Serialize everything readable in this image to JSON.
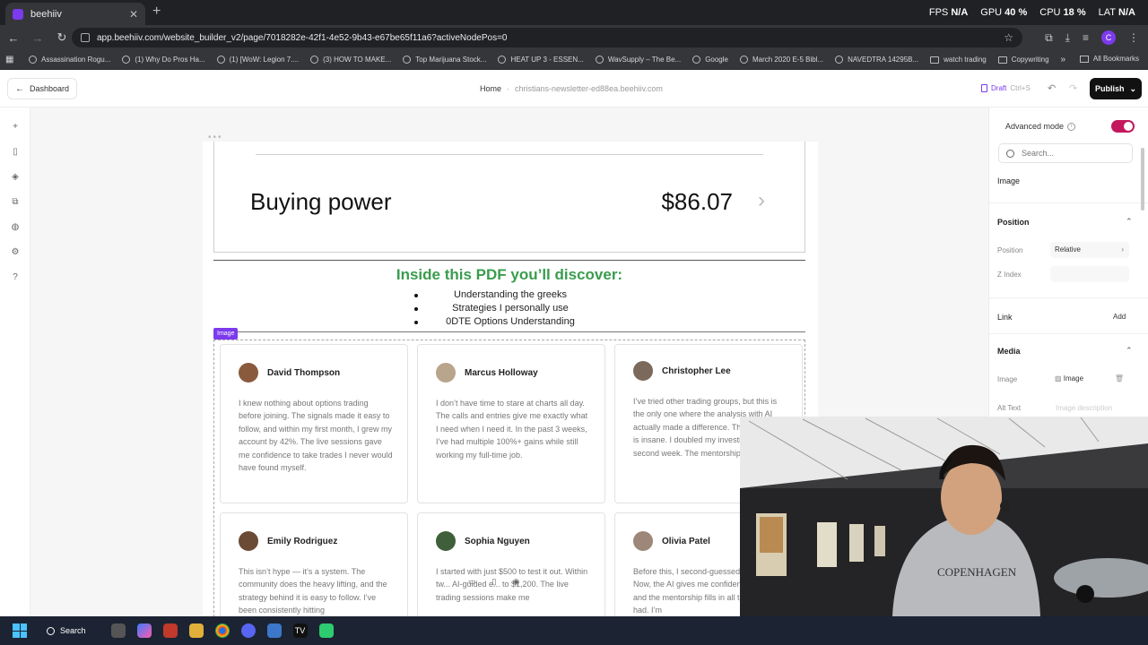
{
  "browser": {
    "tab_title": "beehiiv",
    "url": "app.beehiiv.com/website_builder_v2/page/7018282e-42f1-4e52-9b43-e67be65f11a6?activeNodePos=0",
    "overlay": {
      "fps_label": "FPS",
      "fps_value": "N/A",
      "gpu_label": "GPU",
      "gpu_value": "40 %",
      "cpu_label": "CPU",
      "cpu_value": "18 %",
      "lat_label": "LAT",
      "lat_value": "N/A"
    },
    "bookmarks": [
      "Assassination Rogu...",
      "(1) Why Do Pros Ha...",
      "(1) [WoW: Legion 7....",
      "(3) HOW TO MAKE...",
      "Top Marijuana Stock...",
      "HEAT UP 3 - ESSEN...",
      "WavSupply – The Be...",
      "Google",
      "March 2020 E-5 Bibl...",
      "NAVEDTRA 14295B...",
      "watch trading",
      "Copywriting"
    ],
    "all_bookmarks": "All Bookmarks",
    "profile_initial": "C"
  },
  "header": {
    "dashboard_label": "Dashboard",
    "breadcrumb_home": "Home",
    "breadcrumb_sep": "·",
    "breadcrumb_site": "christians-newsletter-ed88ea.beehiiv.com",
    "draft_label": "Draft",
    "draft_shortcut": "Ctrl+S",
    "publish_label": "Publish"
  },
  "canvas": {
    "buying_power_label": "Buying power",
    "buying_power_value": "$86.07",
    "pdf_title": "Inside this PDF you’ll discover:",
    "pdf_items": [
      "Understanding the greeks",
      "Strategies I personally use",
      "0DTE Options Understanding"
    ],
    "image_tag": "Image",
    "testimonials": [
      {
        "name": "David Thompson",
        "quote": "I knew nothing about options trading before joining. The signals made it easy to follow, and within my first month, I grew my account by 42%. The live sessions gave me confidence to take trades I never would have found myself."
      },
      {
        "name": "Marcus Holloway",
        "quote": "I don’t have time to stare at charts all day. The calls and entries give me exactly what I need when I need it. In the past 3 weeks, I’ve had multiple 100%+ gains while still working my full-time job."
      },
      {
        "name": "Christopher Lee",
        "quote": "I’ve tried other trading groups, but this is the only one where the analysis with AI actually made a difference. The accuracy is insane. I doubled my investment on the second week. The mentorship is priceless."
      },
      {
        "name": "Emily Rodriguez",
        "quote": "This isn’t hype — it’s a system. The community does the heavy lifting, and the strategy behind it is easy to follow. I’ve been consistently hitting"
      },
      {
        "name": "Sophia Nguyen",
        "quote": "I started with just $500 to test it out. Within tw... AI-guided e... to $1,200. The live trading sessions make me"
      },
      {
        "name": "Olivia Patel",
        "quote": "Before this, I second-guessed every trade. Now, the AI gives me confident entries, and the mentorship fills in all the gaps I had. I’m"
      }
    ]
  },
  "panel": {
    "advanced_mode_label": "Advanced mode",
    "search_placeholder": "Search...",
    "element_type": "Image",
    "position_section": "Position",
    "position_label": "Position",
    "position_value": "Relative",
    "zindex_label": "Z Index",
    "link_section": "Link",
    "link_add": "Add",
    "media_section": "Media",
    "image_label": "Image",
    "image_value": "Image",
    "alt_label": "Alt Text",
    "alt_placeholder": "Image description"
  },
  "taskbar": {
    "search_label": "Search"
  },
  "colors": {
    "brand_purple": "#7c3aed",
    "pdf_title_green": "#3a9c4e",
    "toggle_on": "#c3185d",
    "taskbar_bg": "#1c2433"
  }
}
